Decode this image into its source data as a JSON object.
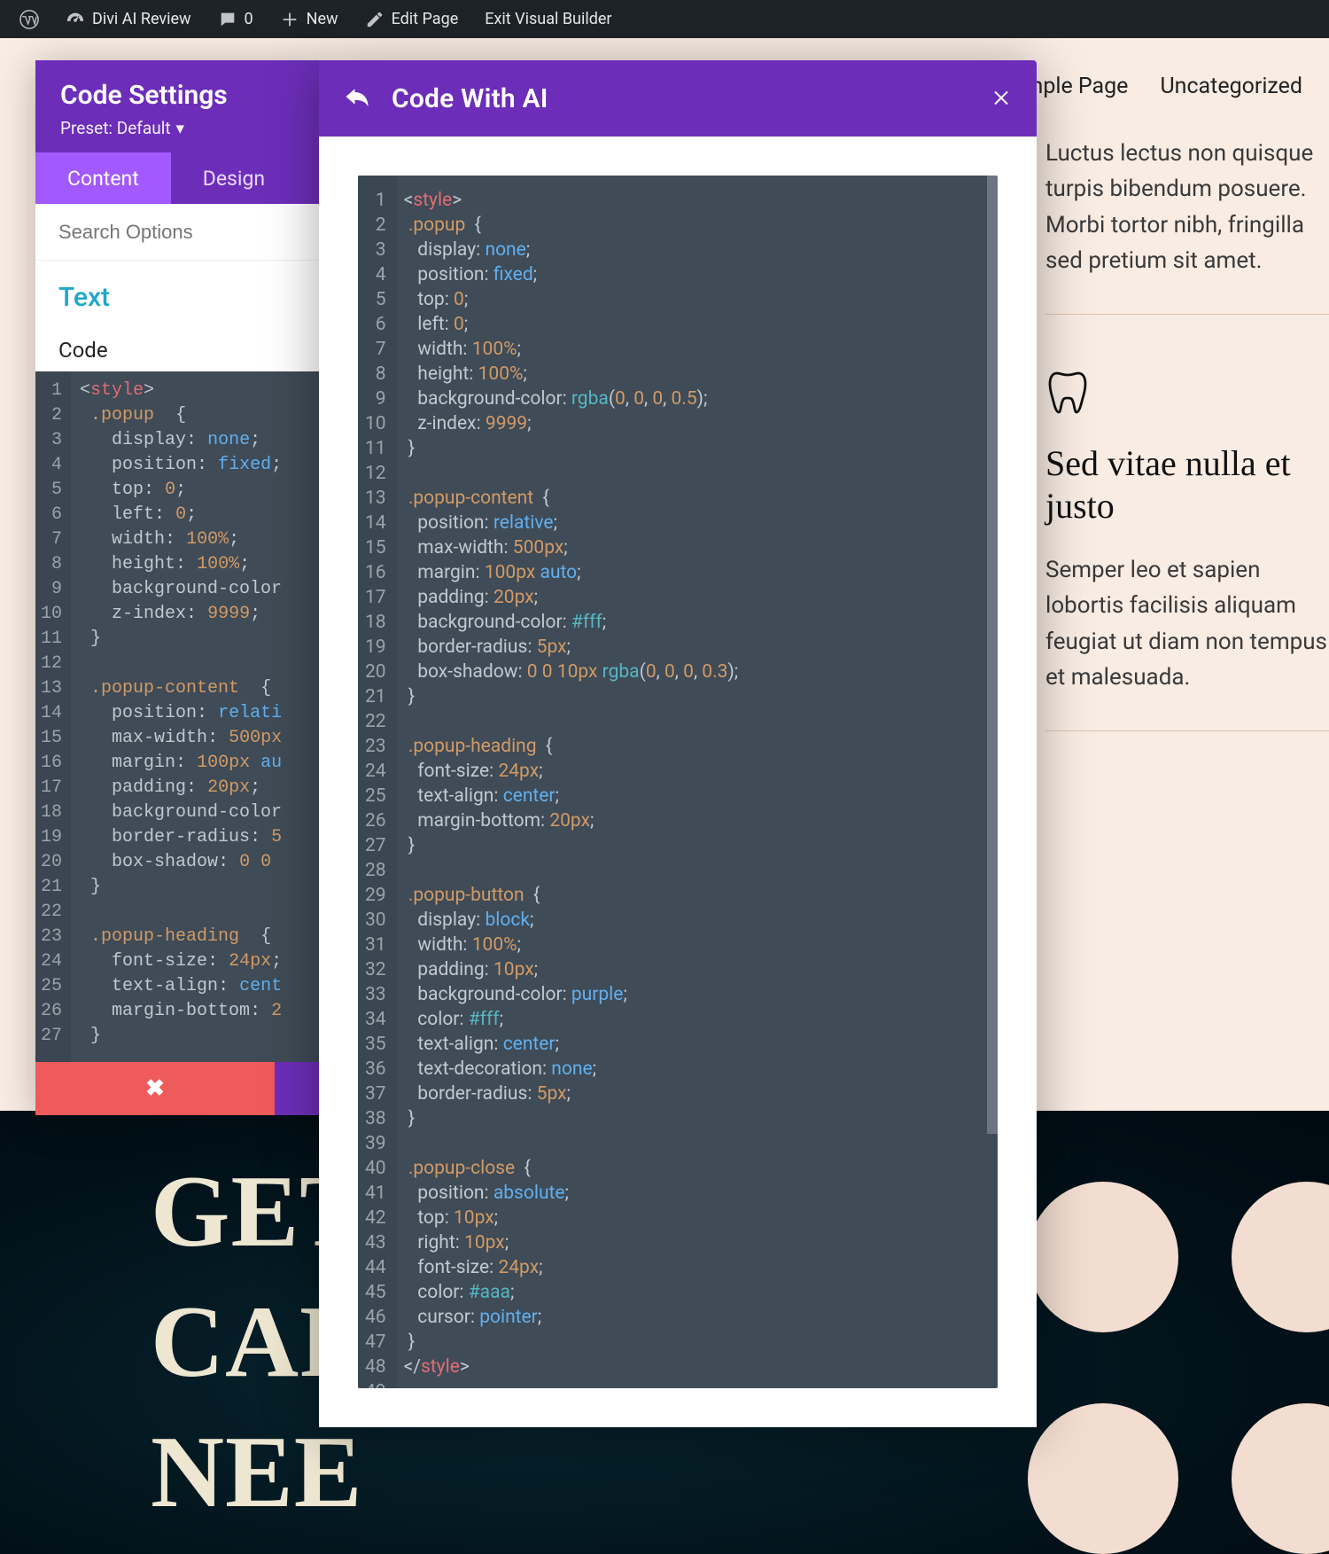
{
  "wp_bar": {
    "site_title": "Divi AI Review",
    "comments": "0",
    "new_label": "New",
    "edit_page": "Edit Page",
    "exit_vb": "Exit Visual Builder"
  },
  "top_nav": {
    "item1": "Sample Page",
    "item2": "Uncategorized"
  },
  "side": {
    "para1": "Luctus lectus non quisque turpis bibendum posuere. Morbi tortor nibh, fringilla sed pretium sit amet.",
    "heading2": "Sed vitae nulla et justo",
    "para2": "Semper leo et sapien lobortis facilisis aliquam feugiat ut diam non tempus et malesuada."
  },
  "hero": {
    "line1": "GET",
    "line2": "CAR",
    "line3": "NEE"
  },
  "settings": {
    "title": "Code Settings",
    "preset": "Preset: Default",
    "tab_content": "Content",
    "tab_design": "Design",
    "search_ph": "Search Options",
    "section_text": "Text",
    "code_label": "Code"
  },
  "ai": {
    "title": "Code With AI"
  },
  "left_code": [
    {
      "html": "<span class='c-punc'>&lt;</span><span class='c-tag'>style</span><span class='c-punc'>&gt;</span>"
    },
    {
      "html": " <span class='c-sel'>.popup</span>  <span class='c-punc'>{</span>"
    },
    {
      "html": "   <span class='c-prop'>display</span><span class='c-punc'>:</span> <span class='c-kw'>none</span><span class='c-punc'>;</span>"
    },
    {
      "html": "   <span class='c-prop'>position</span><span class='c-punc'>:</span> <span class='c-kw'>fixed</span><span class='c-punc'>;</span>"
    },
    {
      "html": "   <span class='c-prop'>top</span><span class='c-punc'>:</span> <span class='c-num'>0</span><span class='c-punc'>;</span>"
    },
    {
      "html": "   <span class='c-prop'>left</span><span class='c-punc'>:</span> <span class='c-num'>0</span><span class='c-punc'>;</span>"
    },
    {
      "html": "   <span class='c-prop'>width</span><span class='c-punc'>:</span> <span class='c-num'>100%</span><span class='c-punc'>;</span>"
    },
    {
      "html": "   <span class='c-prop'>height</span><span class='c-punc'>:</span> <span class='c-num'>100%</span><span class='c-punc'>;</span>"
    },
    {
      "html": "   <span class='c-prop'>background-color</span>"
    },
    {
      "html": "   <span class='c-prop'>z-index</span><span class='c-punc'>:</span> <span class='c-num'>9999</span><span class='c-punc'>;</span>"
    },
    {
      "html": " <span class='c-punc'>}</span>"
    },
    {
      "html": " "
    },
    {
      "html": " <span class='c-sel'>.popup-content</span>  <span class='c-punc'>{</span>"
    },
    {
      "html": "   <span class='c-prop'>position</span><span class='c-punc'>:</span> <span class='c-kw'>relati</span>"
    },
    {
      "html": "   <span class='c-prop'>max-width</span><span class='c-punc'>:</span> <span class='c-num'>500px</span>"
    },
    {
      "html": "   <span class='c-prop'>margin</span><span class='c-punc'>:</span> <span class='c-num'>100px</span> <span class='c-kw'>au</span>"
    },
    {
      "html": "   <span class='c-prop'>padding</span><span class='c-punc'>:</span> <span class='c-num'>20px</span><span class='c-punc'>;</span>"
    },
    {
      "html": "   <span class='c-prop'>background-color</span>"
    },
    {
      "html": "   <span class='c-prop'>border-radius</span><span class='c-punc'>:</span> <span class='c-num'>5</span>"
    },
    {
      "html": "   <span class='c-prop'>box-shadow</span><span class='c-punc'>:</span> <span class='c-num'>0 0</span>"
    },
    {
      "html": " <span class='c-punc'>}</span>"
    },
    {
      "html": " "
    },
    {
      "html": " <span class='c-sel'>.popup-heading</span>  <span class='c-punc'>{</span>"
    },
    {
      "html": "   <span class='c-prop'>font-size</span><span class='c-punc'>:</span> <span class='c-num'>24px</span><span class='c-punc'>;</span>"
    },
    {
      "html": "   <span class='c-prop'>text-align</span><span class='c-punc'>:</span> <span class='c-kw'>cent</span>"
    },
    {
      "html": "   <span class='c-prop'>margin-bottom</span><span class='c-punc'>:</span> <span class='c-num'>2</span>"
    },
    {
      "html": " <span class='c-punc'>}</span>"
    }
  ],
  "ai_code": [
    {
      "html": "<span class='c-punc'>&lt;</span><span class='c-tag'>style</span><span class='c-punc'>&gt;</span>"
    },
    {
      "html": " <span class='c-sel'>.popup</span>  <span class='c-punc'>{</span>"
    },
    {
      "html": "   <span class='c-prop'>display</span><span class='c-punc'>:</span> <span class='c-kw'>none</span><span class='c-punc'>;</span>"
    },
    {
      "html": "   <span class='c-prop'>position</span><span class='c-punc'>:</span> <span class='c-kw'>fixed</span><span class='c-punc'>;</span>"
    },
    {
      "html": "   <span class='c-prop'>top</span><span class='c-punc'>:</span> <span class='c-num'>0</span><span class='c-punc'>;</span>"
    },
    {
      "html": "   <span class='c-prop'>left</span><span class='c-punc'>:</span> <span class='c-num'>0</span><span class='c-punc'>;</span>"
    },
    {
      "html": "   <span class='c-prop'>width</span><span class='c-punc'>:</span> <span class='c-num'>100%</span><span class='c-punc'>;</span>"
    },
    {
      "html": "   <span class='c-prop'>height</span><span class='c-punc'>:</span> <span class='c-num'>100%</span><span class='c-punc'>;</span>"
    },
    {
      "html": "   <span class='c-prop'>background-color</span><span class='c-punc'>:</span> <span class='c-fn'>rgba</span><span class='c-punc'>(</span><span class='c-num'>0</span><span class='c-punc'>, </span><span class='c-num'>0</span><span class='c-punc'>, </span><span class='c-num'>0</span><span class='c-punc'>, </span><span class='c-num'>0.5</span><span class='c-punc'>);</span>"
    },
    {
      "html": "   <span class='c-prop'>z-index</span><span class='c-punc'>:</span> <span class='c-num'>9999</span><span class='c-punc'>;</span>"
    },
    {
      "html": " <span class='c-punc'>}</span>"
    },
    {
      "html": " "
    },
    {
      "html": " <span class='c-sel'>.popup-content</span>  <span class='c-punc'>{</span>"
    },
    {
      "html": "   <span class='c-prop'>position</span><span class='c-punc'>:</span> <span class='c-kw'>relative</span><span class='c-punc'>;</span>"
    },
    {
      "html": "   <span class='c-prop'>max-width</span><span class='c-punc'>:</span> <span class='c-num'>500px</span><span class='c-punc'>;</span>"
    },
    {
      "html": "   <span class='c-prop'>margin</span><span class='c-punc'>:</span> <span class='c-num'>100px</span> <span class='c-kw'>auto</span><span class='c-punc'>;</span>"
    },
    {
      "html": "   <span class='c-prop'>padding</span><span class='c-punc'>:</span> <span class='c-num'>20px</span><span class='c-punc'>;</span>"
    },
    {
      "html": "   <span class='c-prop'>background-color</span><span class='c-punc'>:</span> <span class='c-hex'>#fff</span><span class='c-punc'>;</span>"
    },
    {
      "html": "   <span class='c-prop'>border-radius</span><span class='c-punc'>:</span> <span class='c-num'>5px</span><span class='c-punc'>;</span>"
    },
    {
      "html": "   <span class='c-prop'>box-shadow</span><span class='c-punc'>:</span> <span class='c-num'>0 0 10px</span> <span class='c-fn'>rgba</span><span class='c-punc'>(</span><span class='c-num'>0</span><span class='c-punc'>, </span><span class='c-num'>0</span><span class='c-punc'>, </span><span class='c-num'>0</span><span class='c-punc'>, </span><span class='c-num'>0.3</span><span class='c-punc'>);</span>"
    },
    {
      "html": " <span class='c-punc'>}</span>"
    },
    {
      "html": " "
    },
    {
      "html": " <span class='c-sel'>.popup-heading</span>  <span class='c-punc'>{</span>"
    },
    {
      "html": "   <span class='c-prop'>font-size</span><span class='c-punc'>:</span> <span class='c-num'>24px</span><span class='c-punc'>;</span>"
    },
    {
      "html": "   <span class='c-prop'>text-align</span><span class='c-punc'>:</span> <span class='c-kw'>center</span><span class='c-punc'>;</span>"
    },
    {
      "html": "   <span class='c-prop'>margin-bottom</span><span class='c-punc'>:</span> <span class='c-num'>20px</span><span class='c-punc'>;</span>"
    },
    {
      "html": " <span class='c-punc'>}</span>"
    },
    {
      "html": " "
    },
    {
      "html": " <span class='c-sel'>.popup-button</span>  <span class='c-punc'>{</span>"
    },
    {
      "html": "   <span class='c-prop'>display</span><span class='c-punc'>:</span> <span class='c-kw'>block</span><span class='c-punc'>;</span>"
    },
    {
      "html": "   <span class='c-prop'>width</span><span class='c-punc'>:</span> <span class='c-num'>100%</span><span class='c-punc'>;</span>"
    },
    {
      "html": "   <span class='c-prop'>padding</span><span class='c-punc'>:</span> <span class='c-num'>10px</span><span class='c-punc'>;</span>"
    },
    {
      "html": "   <span class='c-prop'>background-color</span><span class='c-punc'>:</span> <span class='c-kw'>purple</span><span class='c-punc'>;</span>"
    },
    {
      "html": "   <span class='c-prop'>color</span><span class='c-punc'>:</span> <span class='c-hex'>#fff</span><span class='c-punc'>;</span>"
    },
    {
      "html": "   <span class='c-prop'>text-align</span><span class='c-punc'>:</span> <span class='c-kw'>center</span><span class='c-punc'>;</span>"
    },
    {
      "html": "   <span class='c-prop'>text-decoration</span><span class='c-punc'>:</span> <span class='c-kw'>none</span><span class='c-punc'>;</span>"
    },
    {
      "html": "   <span class='c-prop'>border-radius</span><span class='c-punc'>:</span> <span class='c-num'>5px</span><span class='c-punc'>;</span>"
    },
    {
      "html": " <span class='c-punc'>}</span>"
    },
    {
      "html": " "
    },
    {
      "html": " <span class='c-sel'>.popup-close</span>  <span class='c-punc'>{</span>"
    },
    {
      "html": "   <span class='c-prop'>position</span><span class='c-punc'>:</span> <span class='c-kw'>absolute</span><span class='c-punc'>;</span>"
    },
    {
      "html": "   <span class='c-prop'>top</span><span class='c-punc'>:</span> <span class='c-num'>10px</span><span class='c-punc'>;</span>"
    },
    {
      "html": "   <span class='c-prop'>right</span><span class='c-punc'>:</span> <span class='c-num'>10px</span><span class='c-punc'>;</span>"
    },
    {
      "html": "   <span class='c-prop'>font-size</span><span class='c-punc'>:</span> <span class='c-num'>24px</span><span class='c-punc'>;</span>"
    },
    {
      "html": "   <span class='c-prop'>color</span><span class='c-punc'>:</span> <span class='c-hex'>#aaa</span><span class='c-punc'>;</span>"
    },
    {
      "html": "   <span class='c-prop'>cursor</span><span class='c-punc'>:</span> <span class='c-kw'>pointer</span><span class='c-punc'>;</span>"
    },
    {
      "html": " <span class='c-punc'>}</span>"
    },
    {
      "html": "<span class='c-punc'>&lt;/</span><span class='c-tag'>style</span><span class='c-punc'>&gt;</span>"
    },
    {
      "html": " "
    }
  ]
}
